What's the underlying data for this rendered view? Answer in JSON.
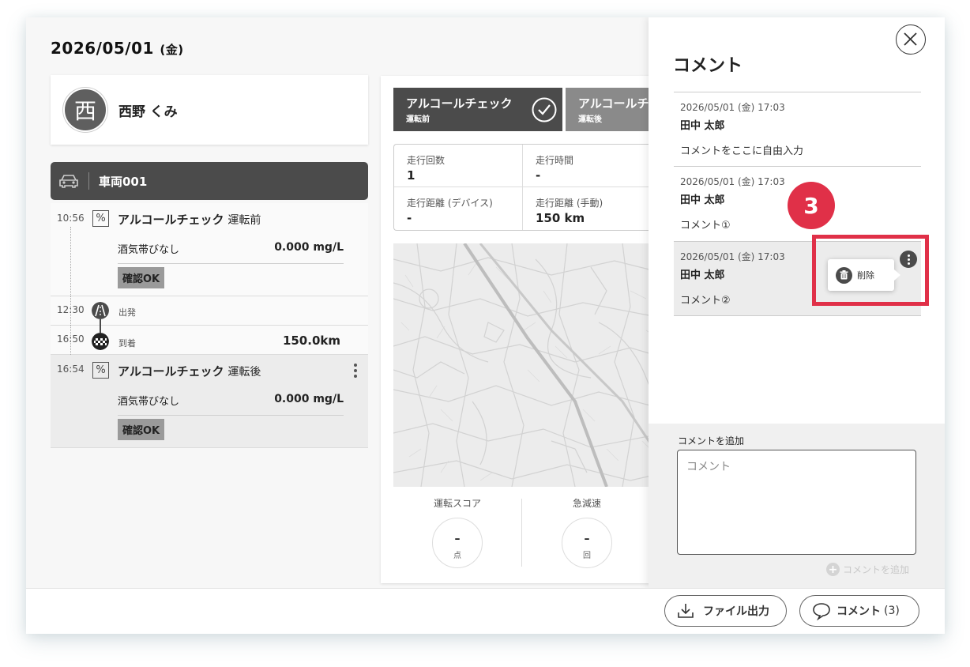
{
  "header": {
    "date": "2026/05/01",
    "dow": "(金)"
  },
  "user": {
    "avatar_char": "西",
    "name": "西野 くみ"
  },
  "vehicle": {
    "name": "車両001"
  },
  "timeline": {
    "check_before": {
      "time": "10:56",
      "title": "アルコールチェック",
      "phase": "運転前",
      "detail": "酒気帯びなし",
      "value": "0.000 mg/L",
      "status": "確認OK"
    },
    "depart": {
      "time": "12:30",
      "label": "出発"
    },
    "arrive": {
      "time": "16:50",
      "label": "到着",
      "value": "150.0km"
    },
    "check_after": {
      "time": "16:54",
      "title": "アルコールチェック",
      "phase": "運転後",
      "detail": "酒気帯びなし",
      "value": "0.000 mg/L",
      "status": "確認OK"
    }
  },
  "center": {
    "tab1": {
      "title": "アルコールチェック",
      "sub": "運転前"
    },
    "tab2": {
      "title": "アルコールチェ",
      "sub": "運転後"
    },
    "stats": [
      {
        "label": "走行回数",
        "value": "1"
      },
      {
        "label": "走行時間",
        "value": "-"
      },
      {
        "label": "走行距離 (デバイス)",
        "value": "-"
      },
      {
        "label": "走行距離 (手動)",
        "value": "150 km"
      }
    ],
    "scores": [
      {
        "label": "運転スコア",
        "value": "–",
        "unit": "点"
      },
      {
        "label": "急減速",
        "value": "–",
        "unit": "回"
      }
    ]
  },
  "comments_panel": {
    "title": "コメント",
    "comments": [
      {
        "timestamp": "2026/05/01 (金) 17:03",
        "author": "田中 太郎",
        "body": "コメントをここに自由入力"
      },
      {
        "timestamp": "2026/05/01 (金) 17:03",
        "author": "田中 太郎",
        "body": "コメント①"
      },
      {
        "timestamp": "2026/05/01 (金) 17:03",
        "author": "田中 太郎",
        "body": "コメント②"
      }
    ],
    "delete_label": "削除",
    "add_label": "コメントを追加",
    "input_placeholder": "コメント",
    "add_button": "コメントを追加"
  },
  "annotation": {
    "step": "3",
    "color": "#e03048"
  },
  "footer": {
    "export_label": "ファイル出力",
    "comment_label": "コメント",
    "comment_count": "(3)"
  }
}
